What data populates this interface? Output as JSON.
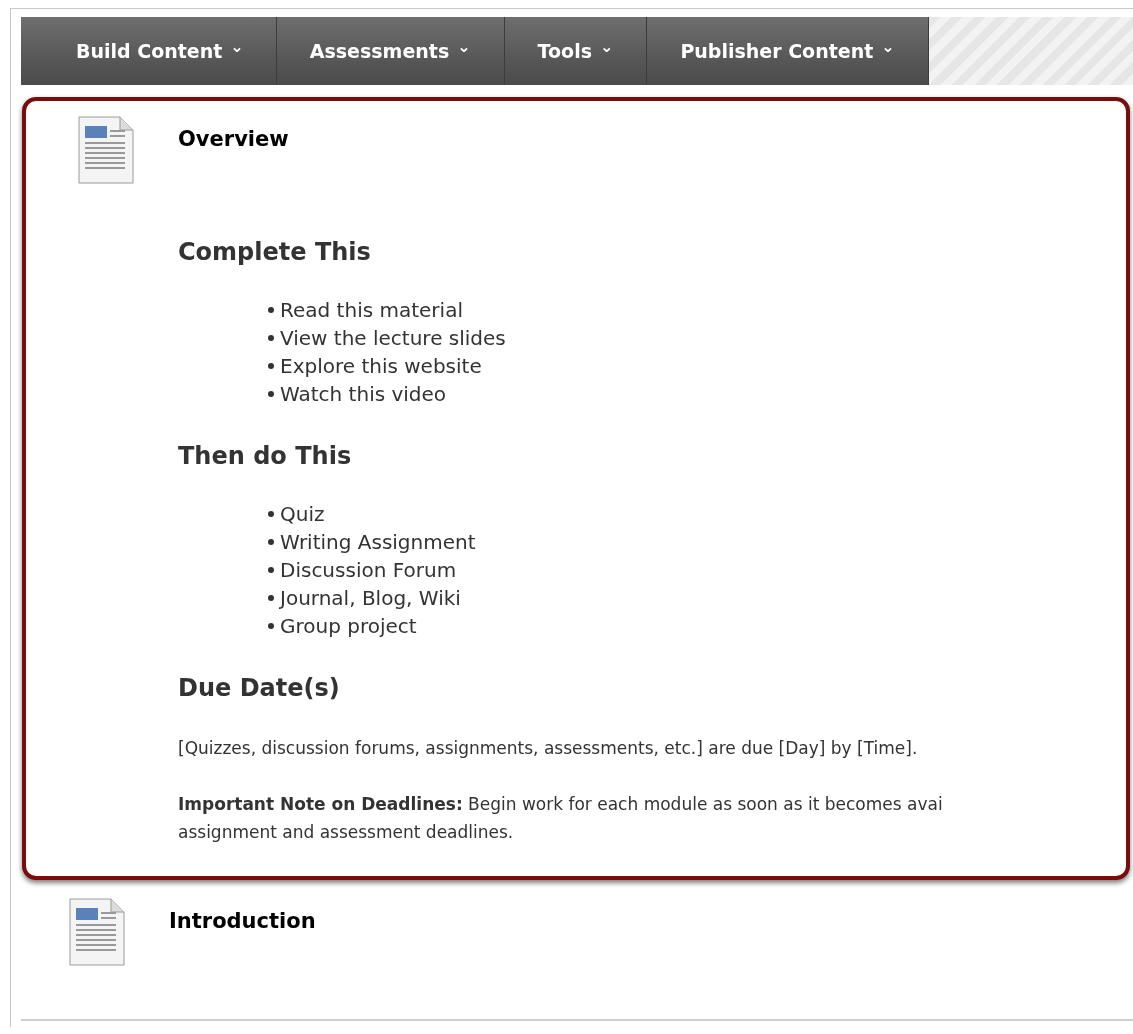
{
  "menu": [
    {
      "label": "Build Content",
      "caret": "⌄"
    },
    {
      "label": "Assessments",
      "caret": "⌄"
    },
    {
      "label": "Tools",
      "caret": "⌄"
    },
    {
      "label": "Publisher Content",
      "caret": "⌄"
    }
  ],
  "items": [
    {
      "title": "Overview",
      "highlighted": true,
      "sections": [
        {
          "heading": "Complete This",
          "bullets": [
            "Read this material",
            "View the lecture slides",
            "Explore this website",
            "Watch this video"
          ]
        },
        {
          "heading": "Then do This",
          "bullets": [
            "Quiz",
            "Writing Assignment",
            "Discussion Forum",
            "Journal, Blog, Wiki",
            "Group project"
          ]
        },
        {
          "heading": "Due Date(s)",
          "paragraphs": [
            [
              "[Quizzes, discussion forums, assignments, assessments, etc.] are due [Day] by [Time]."
            ],
            [
              "**Important Note on Deadlines:** Begin work for each module as soon as it becomes avai",
              "assignment and assessment deadlines."
            ]
          ]
        }
      ]
    },
    {
      "title": "Introduction",
      "highlighted": false
    }
  ]
}
